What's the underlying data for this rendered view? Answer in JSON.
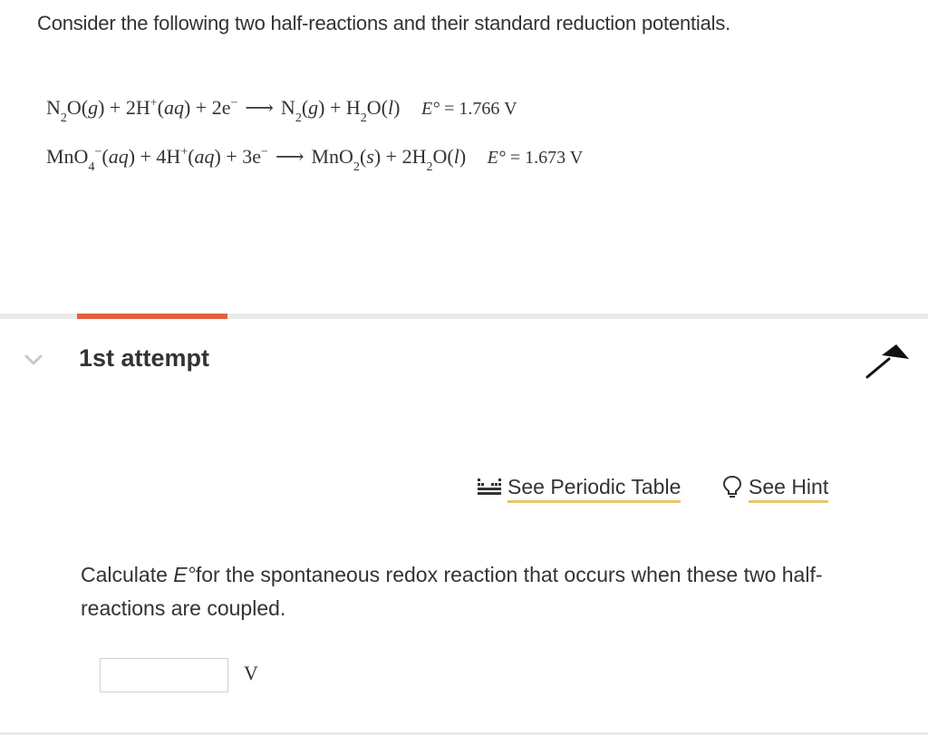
{
  "intro": "Consider the following two half-reactions and their standard reduction potentials.",
  "reactions": [
    {
      "lhs": [
        {
          "t": "N"
        },
        {
          "sub": "2"
        },
        {
          "t": "O("
        },
        {
          "it": "g"
        },
        {
          "t": ") + 2H"
        },
        {
          "sup": "+"
        },
        {
          "t": "("
        },
        {
          "it": "aq"
        },
        {
          "t": ") + 2e"
        },
        {
          "sup": "−"
        }
      ],
      "rhs": [
        {
          "t": "N"
        },
        {
          "sub": "2"
        },
        {
          "t": "("
        },
        {
          "it": "g"
        },
        {
          "t": ") + H"
        },
        {
          "sub": "2"
        },
        {
          "t": "O("
        },
        {
          "it": "l"
        },
        {
          "t": ")"
        }
      ],
      "arrow": "⟶",
      "e_label": "E°",
      "e_value": "= 1.766 V"
    },
    {
      "lhs": [
        {
          "t": "MnO"
        },
        {
          "sub": "4"
        },
        {
          "sup": "−"
        },
        {
          "t": "("
        },
        {
          "it": "aq"
        },
        {
          "t": ") + 4H"
        },
        {
          "sup": "+"
        },
        {
          "t": "("
        },
        {
          "it": "aq"
        },
        {
          "t": ") + 3e"
        },
        {
          "sup": "−"
        }
      ],
      "rhs": [
        {
          "t": "MnO"
        },
        {
          "sub": "2"
        },
        {
          "t": "("
        },
        {
          "it": "s"
        },
        {
          "t": ") + 2H"
        },
        {
          "sub": "2"
        },
        {
          "t": "O("
        },
        {
          "it": "l"
        },
        {
          "t": ")"
        }
      ],
      "arrow": "⟶",
      "e_label": "E°",
      "e_value": "= 1.673 V"
    }
  ],
  "attempt": {
    "title": "1st attempt",
    "chevron_icon": "chevron-down-icon",
    "corner_icon": "arrow-up-left-icon"
  },
  "tools": {
    "periodic_table": {
      "label": "See Periodic Table",
      "icon": "periodic-table-icon"
    },
    "hint": {
      "label": "See Hint",
      "icon": "lightbulb-icon"
    }
  },
  "question": {
    "pre": "Calculate ",
    "symbol": "E°",
    "post": "for the spontaneous redox reaction that occurs when these two half-reactions are coupled."
  },
  "answer": {
    "value": "",
    "unit": "V"
  },
  "colors": {
    "accent": "#e2603f",
    "link_underline": "#e9c46a",
    "text": "#333333",
    "divider": "#eaeaea"
  }
}
